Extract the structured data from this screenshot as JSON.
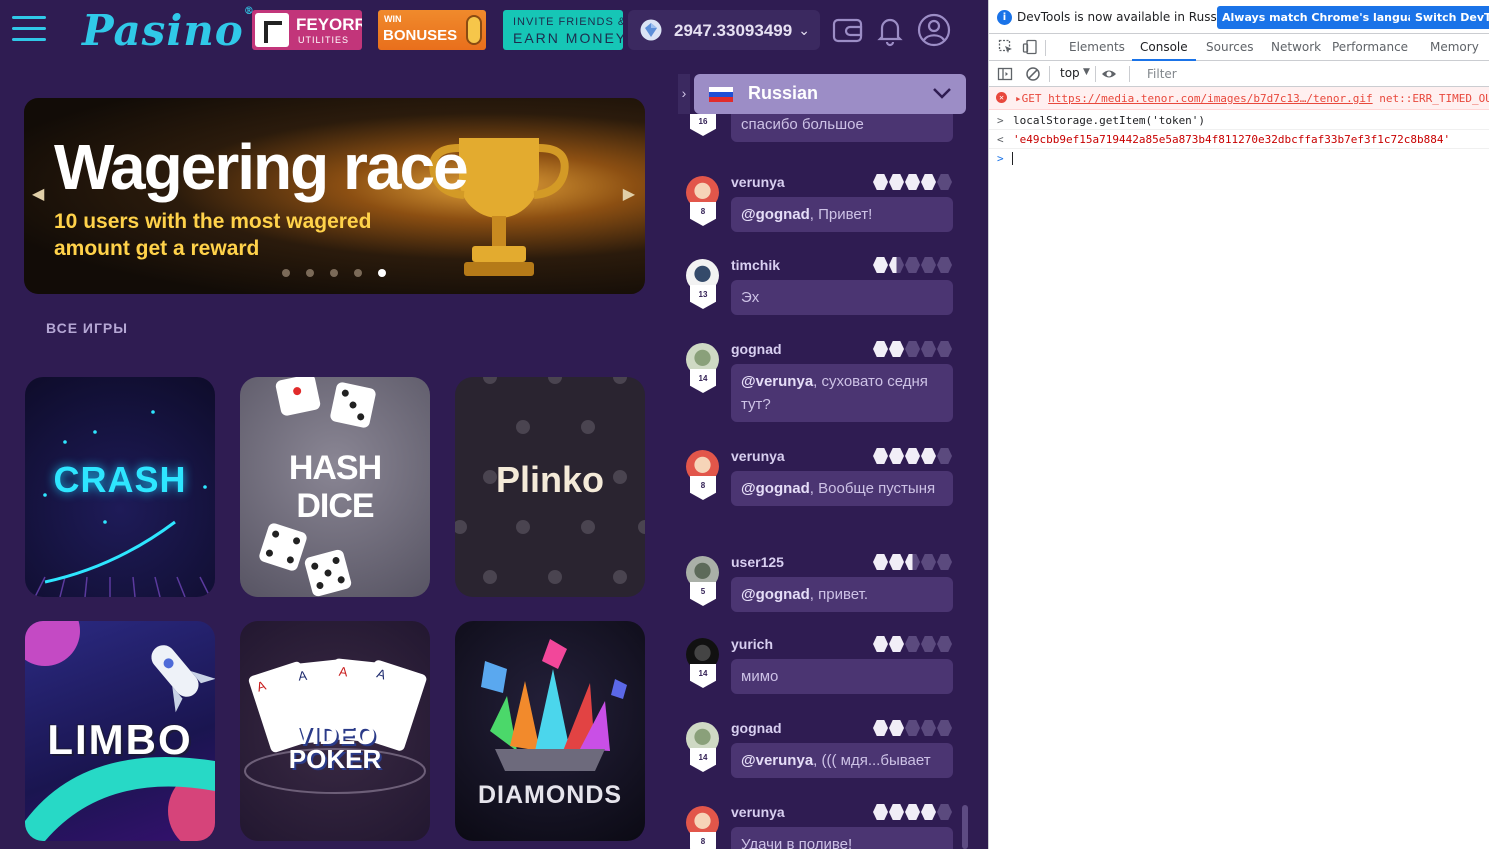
{
  "site": {
    "logo": "Pasino",
    "logo_reg": "®",
    "promos": {
      "feyorra_title": "FEYORRA",
      "feyorra_sub": "UTILITIES",
      "bonus_top": "WIN",
      "bonus_main": "BONUSES",
      "invite_top": "INVITE FRIENDS &",
      "invite_main": "EARN MONEY"
    },
    "balance": "2947.33093499",
    "icons": [
      "menu-icon",
      "diamond-icon",
      "wallet-icon",
      "bell-icon",
      "user-icon"
    ],
    "banner": {
      "title": "Wagering race",
      "subtitle": "10 users with the most wagered amount get a reward",
      "slides_total": 5,
      "active_slide": 5
    },
    "section_title": "ВСЕ ИГРЫ",
    "games": {
      "crash": "CRASH",
      "hash_dice": "HASH DICE",
      "plinko": "Plinko",
      "limbo": "LIMBO",
      "video_poker": "VIDEO POKER",
      "diamonds": "DIAMONDS"
    }
  },
  "chat": {
    "language": "Russian",
    "messages": [
      {
        "user": "",
        "level": "16",
        "rank": 0,
        "mention": "",
        "text": "спасибо большое"
      },
      {
        "user": "verunya",
        "level": "8",
        "rank": 4,
        "mention": "@gognad",
        "text": ", Привет!"
      },
      {
        "user": "timchik",
        "level": "13",
        "rank": 1.5,
        "mention": "",
        "text": "Эх"
      },
      {
        "user": "gognad",
        "level": "14",
        "rank": 2,
        "mention": "@verunya",
        "text": ", суховато седня тут?"
      },
      {
        "user": "verunya",
        "level": "8",
        "rank": 4,
        "mention": "@gognad",
        "text": ", Вообще пустыня"
      },
      {
        "user": "user125",
        "level": "5",
        "rank": 2.5,
        "mention": "@gognad",
        "text": ", привет."
      },
      {
        "user": "yurich",
        "level": "14",
        "rank": 2,
        "mention": "",
        "text": "мимо"
      },
      {
        "user": "gognad",
        "level": "14",
        "rank": 2,
        "mention": "@verunya",
        "text": ", ((( мдя...бывает"
      },
      {
        "user": "verunya",
        "level": "8",
        "rank": 4,
        "mention": "",
        "text": "Удачи в поливе!"
      }
    ]
  },
  "devtools": {
    "info_text": "DevTools is now available in Russian!",
    "btn_match": "Always match Chrome's language",
    "btn_switch": "Switch DevTools",
    "tabs": [
      "Elements",
      "Console",
      "Sources",
      "Network",
      "Performance",
      "Memory"
    ],
    "active_tab": "Console",
    "context": "top",
    "filter_placeholder": "Filter",
    "error_prefix": "▸GET",
    "error_url": "https://media.tenor.com/images/b7d7c13…/tenor.gif",
    "error_msg": "net::ERR_TIMED_OUT",
    "command": "localStorage.getItem('token')",
    "result": "'e49cbb9ef15a719442a85e5a873b4f811270e32dbcffaf33b7ef3f1c72c8b884'",
    "prompt_prefix": ">",
    "cmd_prefix": ">",
    "res_prefix": "<"
  }
}
